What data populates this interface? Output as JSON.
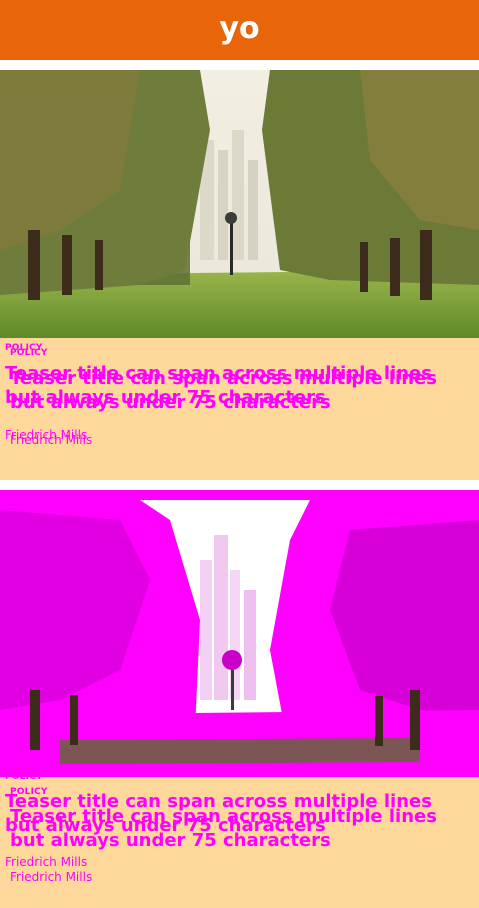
{
  "header": {
    "title": "yo",
    "background": "#e8650a"
  },
  "cards": [
    {
      "category": "POLICY",
      "title": "Teaser title can span across multiple lines but always under 75 characters",
      "author": "Friedrich Mills",
      "image_icon": "palm-avenue-photo"
    },
    {
      "category": "POLICY",
      "title": "Teaser title can span across multiple lines but always under 75 characters",
      "author": "Friedrich Mills",
      "image_icon": "palm-avenue-photo-magenta"
    }
  ],
  "colors": {
    "accent": "#ff00ff",
    "card_background": "#fdd89a"
  }
}
